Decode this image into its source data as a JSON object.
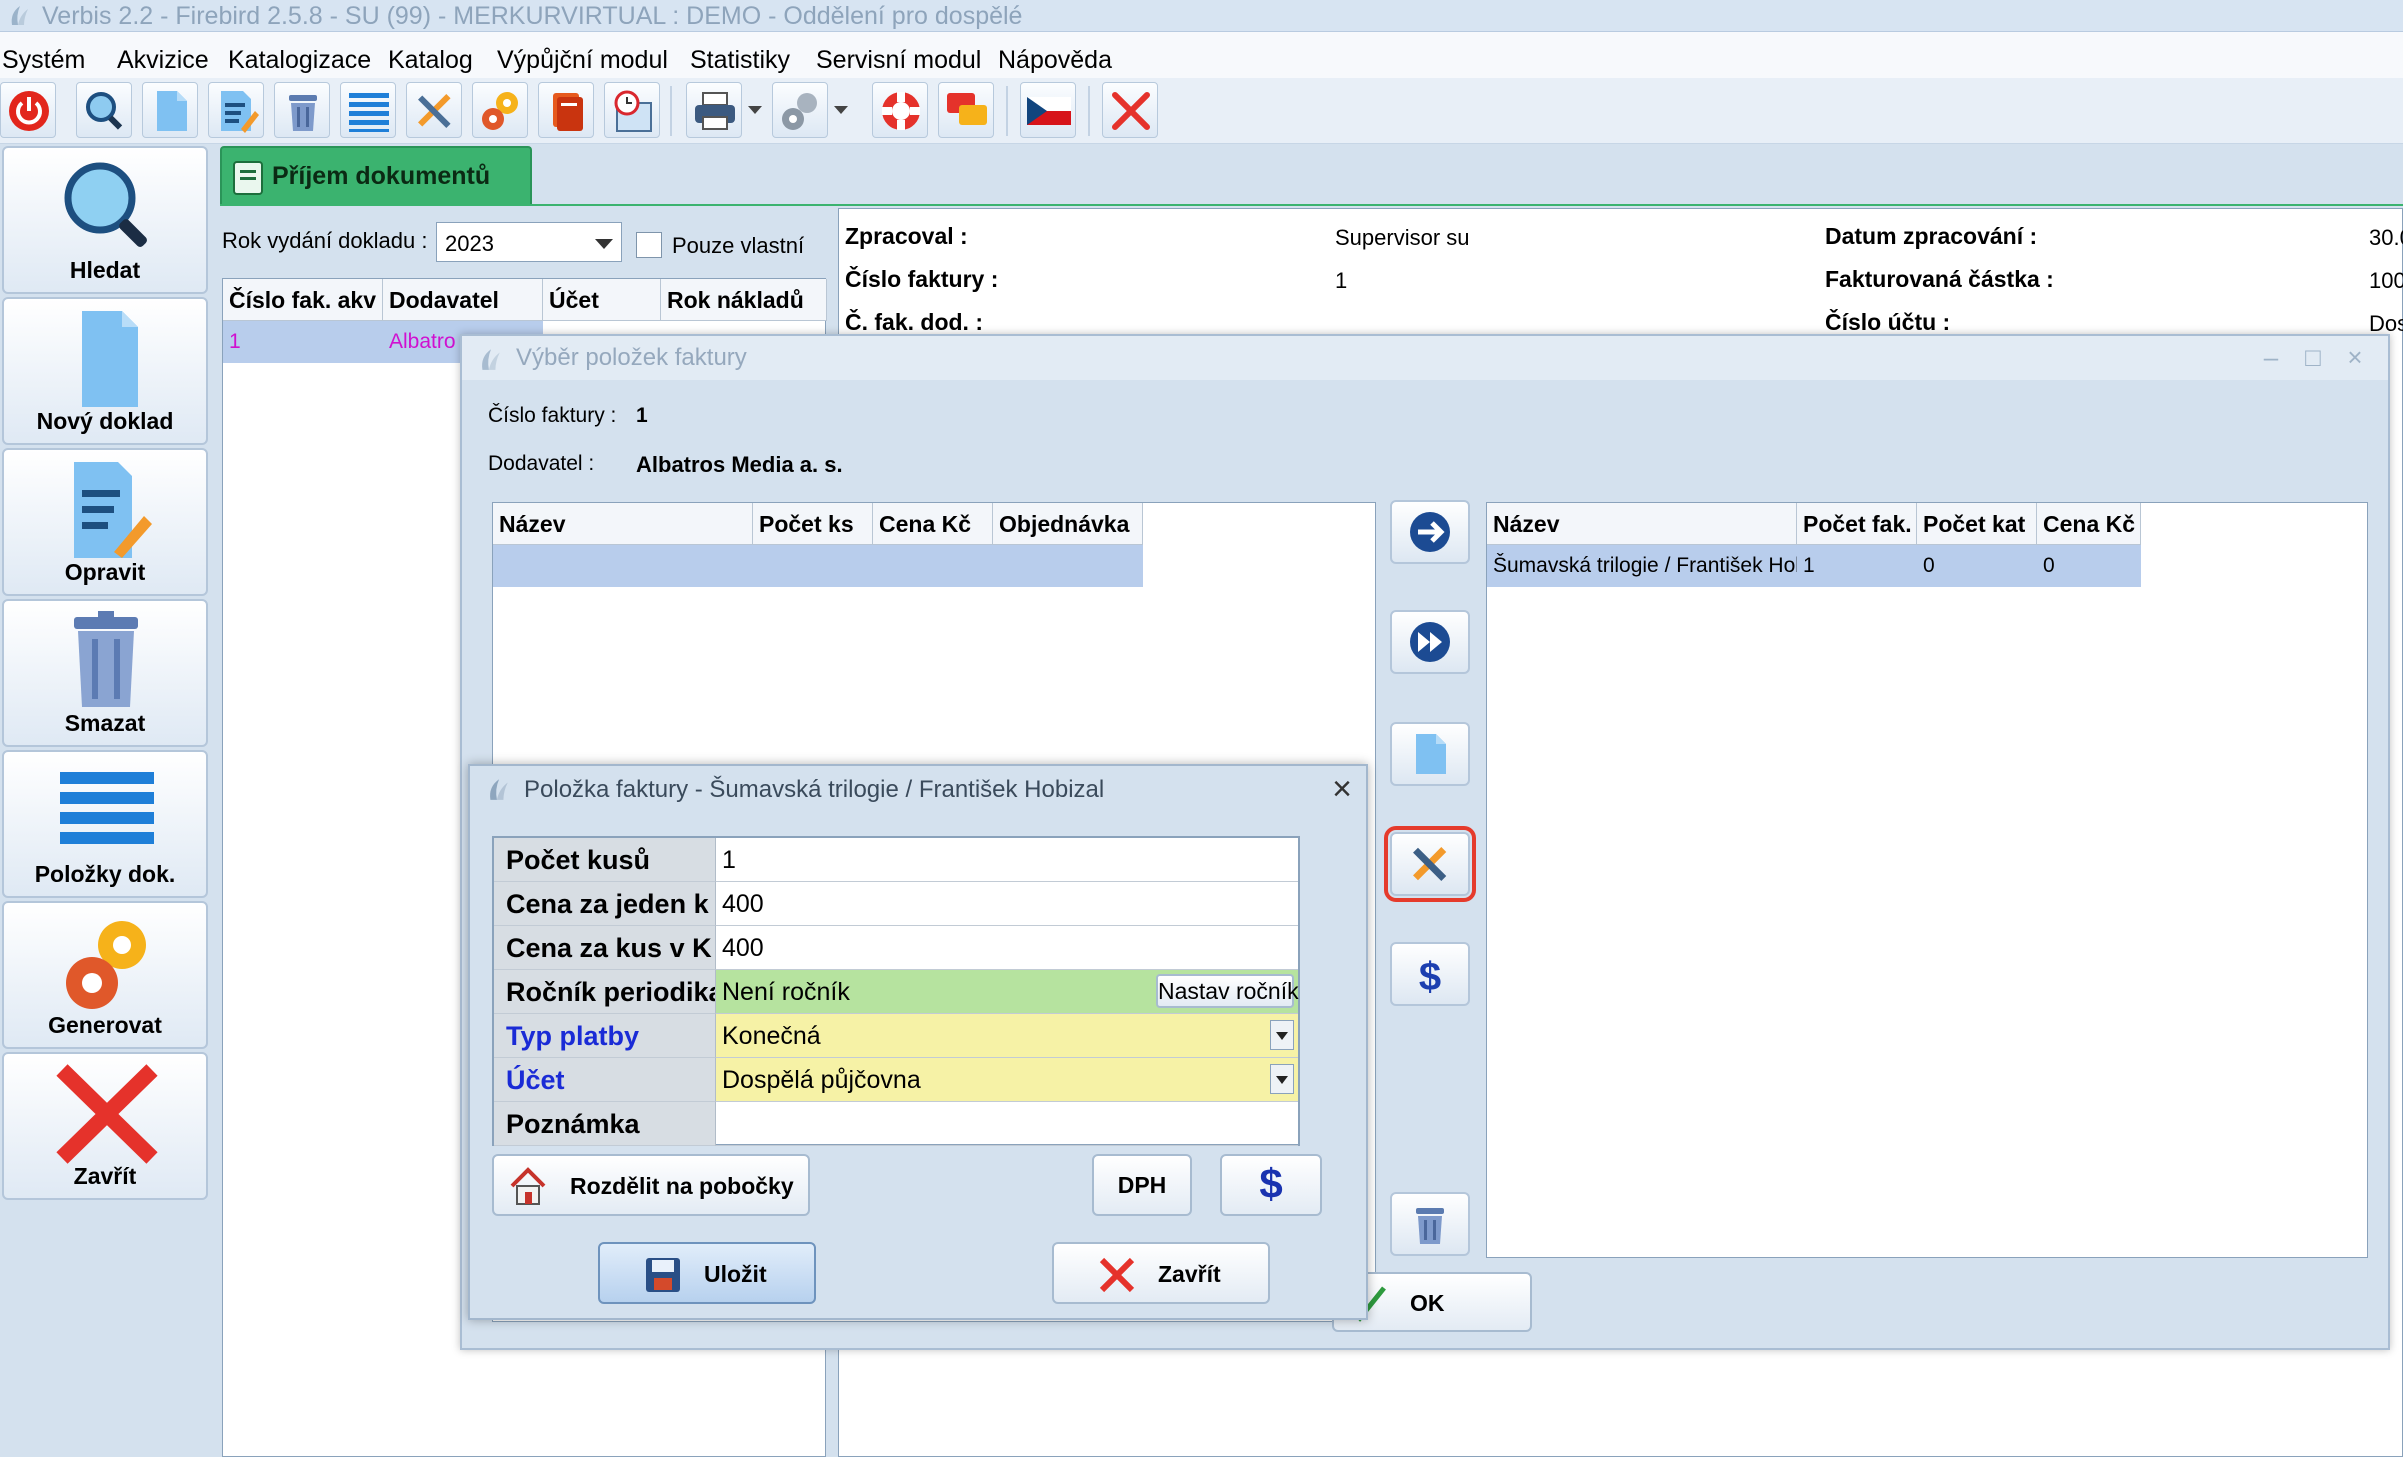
{
  "window": {
    "title": "Verbis 2.2 - Firebird 2.5.8 - SU (99) - MERKURVIRTUAL : DEMO - Oddělení pro dospělé"
  },
  "menu": [
    "Systém",
    "Akvizice",
    "Katalogizace",
    "Katalog",
    "Výpůjční modul",
    "Statistiky",
    "Servisní modul",
    "Nápověda"
  ],
  "toolbar": {
    "icons": [
      "power-icon",
      "search-icon",
      "new-document-icon",
      "edit-icon",
      "trash-icon",
      "list-icon",
      "tools-icon",
      "gears-icon",
      "books-icon",
      "calendar-icon",
      "printer-icon",
      "settings-icon",
      "lifebuoy-icon",
      "chat-icon",
      "czech-flag-icon",
      "close-icon"
    ]
  },
  "nav": [
    {
      "label": "Hledat",
      "icon": "magnifier-icon"
    },
    {
      "label": "Nový doklad",
      "icon": "document-icon"
    },
    {
      "label": "Opravit",
      "icon": "edit-document-icon"
    },
    {
      "label": "Smazat",
      "icon": "trash-icon"
    },
    {
      "label": "Položky dok.",
      "icon": "list-icon"
    },
    {
      "label": "Generovat",
      "icon": "gears-icon"
    },
    {
      "label": "Zavřít",
      "icon": "close-icon"
    }
  ],
  "tab": {
    "label": "Příjem dokumentů"
  },
  "filter": {
    "rok_label": "Rok vydání dokladu :",
    "rok_value": "2023",
    "own_label": "Pouze vlastní"
  },
  "invoice_grid": {
    "headers": [
      "Číslo fak. akv",
      "Dodavatel",
      "Účet",
      "Rok nákladů"
    ],
    "rows": [
      [
        "1",
        "Albatro"
      ]
    ]
  },
  "info": {
    "zpracoval_label": "Zpracoval :",
    "zpracoval_value": "Supervisor su",
    "cislo_label": "Číslo faktury :",
    "cislo_value": "1",
    "cfakdod_label": "Č. fak. dod. :",
    "datum_label": "Datum zpracování :",
    "datum_value": "30.0",
    "castka_label": "Fakturovaná částka :",
    "castka_value": "100",
    "ucet_label": "Číslo účtu :",
    "ucet_value": "Dos"
  },
  "dialog1": {
    "title": "Výběr položek faktury",
    "invoice_label": "Číslo faktury :",
    "invoice_value": "1",
    "supplier_label": "Dodavatel :",
    "supplier_value": "Albatros Media a. s.",
    "left_headers": [
      "Název",
      "Počet ks",
      "Cena Kč",
      "Objednávka"
    ],
    "right_headers": [
      "Název",
      "Počet fak.",
      "Počet kat",
      "Cena Kč"
    ],
    "right_rows": [
      [
        "Šumavská trilogie / František Hobizal",
        "1",
        "0",
        "0"
      ]
    ],
    "ok_label": "OK"
  },
  "dialog2": {
    "title": "Položka faktury - Šumavská trilogie / František Hobizal",
    "fields": [
      {
        "label": "Počet kusů",
        "value": "1"
      },
      {
        "label": "Cena za jeden k",
        "value": "400"
      },
      {
        "label": "Cena za kus v K",
        "value": "400"
      },
      {
        "label": "Ročník periodika",
        "value": "Není ročník"
      },
      {
        "label": "Typ platby",
        "value": "Konečná"
      },
      {
        "label": "Účet",
        "value": "Dospělá půjčovna"
      },
      {
        "label": "Poznámka",
        "value": ""
      }
    ],
    "nastav_label": "Nastav ročník",
    "rozdelit_label": "Rozdělit na pobočky",
    "dph_label": "DPH",
    "dollar_label": "$",
    "ulozit_label": "Uložit",
    "zavrit_label": "Zavřít"
  },
  "colors": {
    "accent_green": "#3bb36f",
    "highlight_red": "#e53b2c",
    "field_green": "#b6e39f",
    "field_yellow": "#f6f2a6",
    "link_blue": "#1a2bd6"
  }
}
